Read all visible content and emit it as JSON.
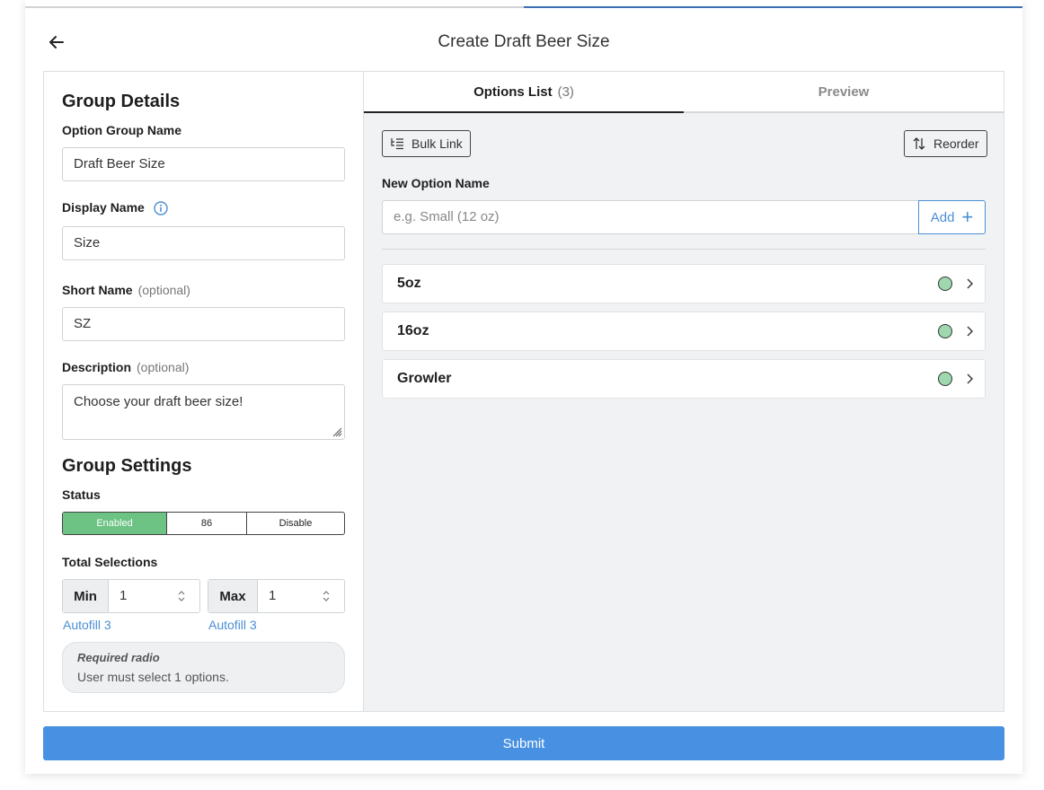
{
  "header": {
    "title": "Create Draft Beer Size"
  },
  "group_details": {
    "heading": "Group Details",
    "option_group_name": {
      "label": "Option Group Name",
      "value": "Draft Beer Size"
    },
    "display_name": {
      "label": "Display Name",
      "value": "Size"
    },
    "short_name": {
      "label": "Short Name",
      "optional": "(optional)",
      "value": "SZ"
    },
    "description": {
      "label": "Description",
      "optional": "(optional)",
      "value": "Choose your draft beer size!"
    }
  },
  "group_settings": {
    "heading": "Group Settings",
    "status": {
      "label": "Status",
      "options": [
        "Enabled",
        "86",
        "Disable"
      ],
      "selected": "Enabled"
    },
    "total_selections": {
      "label": "Total Selections",
      "min": {
        "label": "Min",
        "value": "1",
        "autofill": "Autofill 3"
      },
      "max": {
        "label": "Max",
        "value": "1",
        "autofill": "Autofill 3"
      }
    },
    "required": {
      "title": "Required radio",
      "text": "User must select 1 options."
    }
  },
  "tabs": {
    "options_list": {
      "label": "Options List",
      "count": "(3)"
    },
    "preview": {
      "label": "Preview"
    }
  },
  "toolbar": {
    "bulk_link": "Bulk Link",
    "reorder": "Reorder"
  },
  "new_option": {
    "label": "New Option Name",
    "placeholder": "e.g. Small (12 oz)",
    "add": "Add"
  },
  "options": [
    {
      "name": "5oz",
      "status_color": "#9fd8ae"
    },
    {
      "name": "16oz",
      "status_color": "#9fd8ae"
    },
    {
      "name": "Growler",
      "status_color": "#9fd8ae"
    }
  ],
  "footer": {
    "submit": "Submit"
  },
  "colors": {
    "accent": "#4790e2",
    "enabled": "#6cc383",
    "link": "#4a8fd4"
  }
}
